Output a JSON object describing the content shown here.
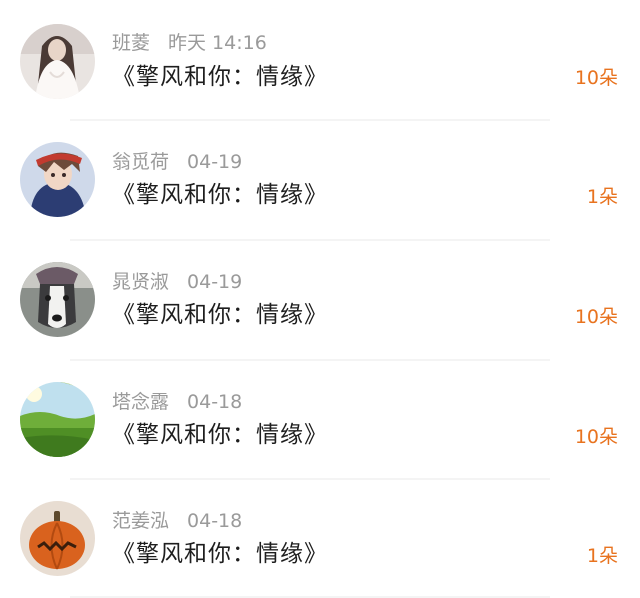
{
  "items": [
    {
      "name": "班菱",
      "time": "昨天 14:16",
      "title": "《擎风和你：情缘》",
      "count": "10朵",
      "avatar": "woman-white-dress-avatar"
    },
    {
      "name": "翁觅荷",
      "time": "04-19",
      "title": "《擎风和你：情缘》",
      "count": "1朵",
      "avatar": "anime-boy-avatar"
    },
    {
      "name": "晁贤淑",
      "time": "04-19",
      "title": "《擎风和你：情缘》",
      "count": "10朵",
      "avatar": "husky-dog-avatar"
    },
    {
      "name": "塔念露",
      "time": "04-18",
      "title": "《擎风和你：情缘》",
      "count": "10朵",
      "avatar": "landscape-avatar"
    },
    {
      "name": "范姜泓",
      "time": "04-18",
      "title": "《擎风和你：情缘》",
      "count": "1朵",
      "avatar": "pumpkin-avatar"
    }
  ],
  "colors": {
    "count": "#e8731f",
    "meta": "#9a9a9a",
    "title": "#1e1e1e"
  }
}
